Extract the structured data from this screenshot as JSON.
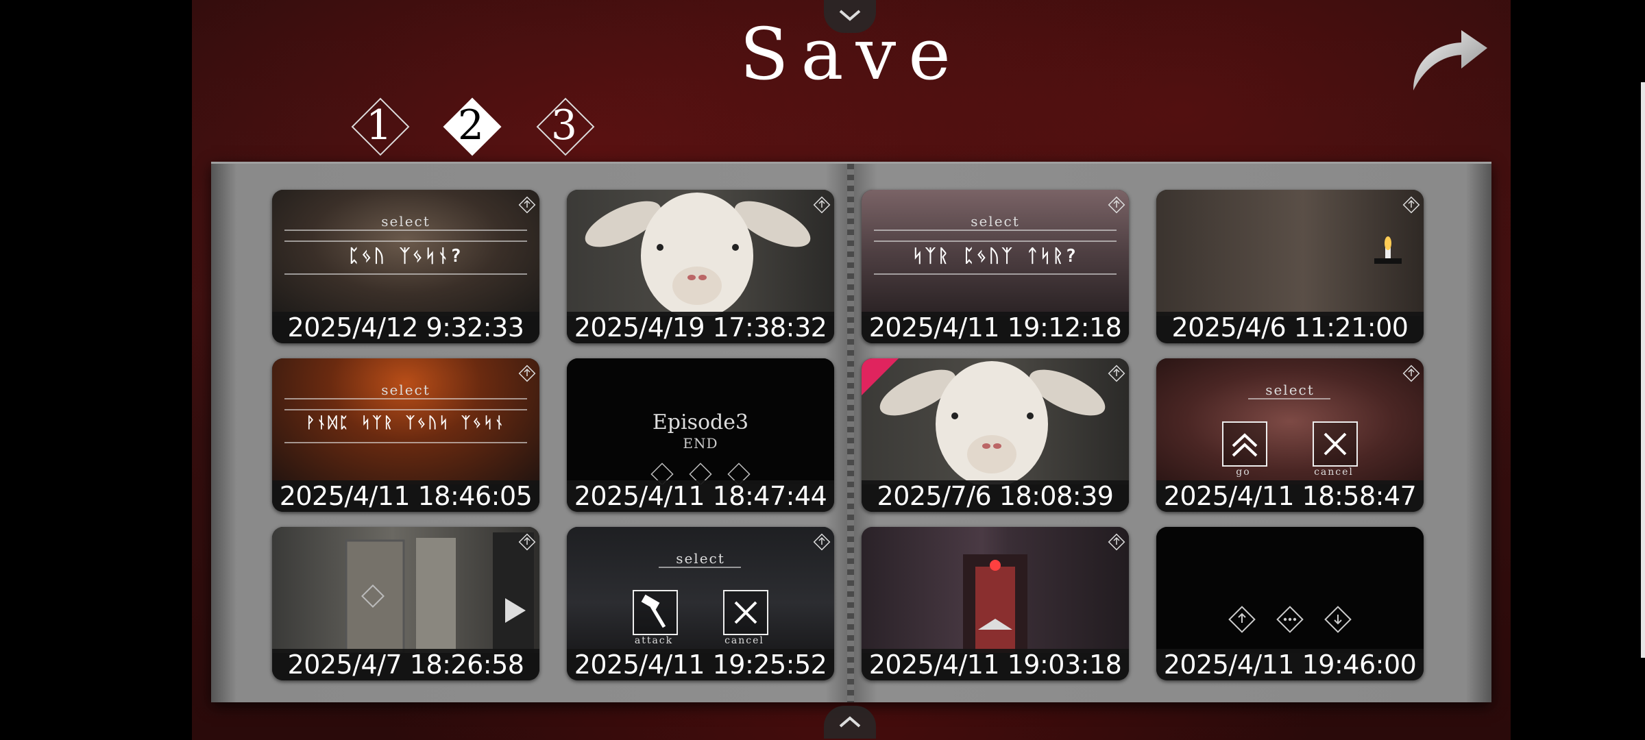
{
  "screen": {
    "title": "Save"
  },
  "page_tabs": [
    {
      "label": "1",
      "active": false
    },
    {
      "label": "2",
      "active": true
    },
    {
      "label": "3",
      "active": false
    }
  ],
  "slots": [
    {
      "date": "2025/4/12 9:32:33",
      "scene": "select-dialog",
      "select_label": "select",
      "line1": "ᛈᛃᚢ ᛉᛃᛋᚾ?"
    },
    {
      "date": "2025/4/19 17:38:32",
      "scene": "goat"
    },
    {
      "date": "2025/4/11 19:12:18",
      "scene": "select-dialog",
      "select_label": "select",
      "line1": "ᛋᛉᚱ ᛈᛃᚢᛉ ᛏᛋᚱ?"
    },
    {
      "date": "2025/4/6 11:21:00",
      "scene": "candle-room"
    },
    {
      "date": "2025/4/11 18:46:05",
      "scene": "select-dialog",
      "select_label": "select",
      "line1": "ᚹᚾᛞᛈ ᛋᛉᚱ ᛉᛃᚢᛋ ᛉᛃᛋᚾ"
    },
    {
      "date": "2025/4/11 18:47:44",
      "scene": "episode-end",
      "episode_title": "Episode3",
      "episode_sub": "END"
    },
    {
      "date": "2025/7/6 18:08:39",
      "scene": "goat"
    },
    {
      "date": "2025/4/11 18:58:47",
      "scene": "go-cancel",
      "select_label": "select",
      "go_label": "go",
      "cancel_label": "cancel"
    },
    {
      "date": "2025/4/7 18:26:58",
      "scene": "hallway"
    },
    {
      "date": "2025/4/11 19:25:52",
      "scene": "attack-cancel",
      "select_label": "select",
      "attack_label": "attack",
      "cancel_label": "cancel"
    },
    {
      "date": "2025/4/11 19:03:18",
      "scene": "red-door"
    },
    {
      "date": "2025/4/11 19:46:00",
      "scene": "empty"
    }
  ],
  "icons": {
    "nav_up": "chevron-down-icon",
    "nav_down": "chevron-up-icon",
    "back": "curved-arrow-icon",
    "share": "share-diamond-icon",
    "more": "more-diamond-icon",
    "download": "download-diamond-icon"
  },
  "colors": {
    "background": "#2a0c0c",
    "album": "#8a8a8a",
    "date_bar": "#141414",
    "accent_marker": "#e0245e"
  }
}
